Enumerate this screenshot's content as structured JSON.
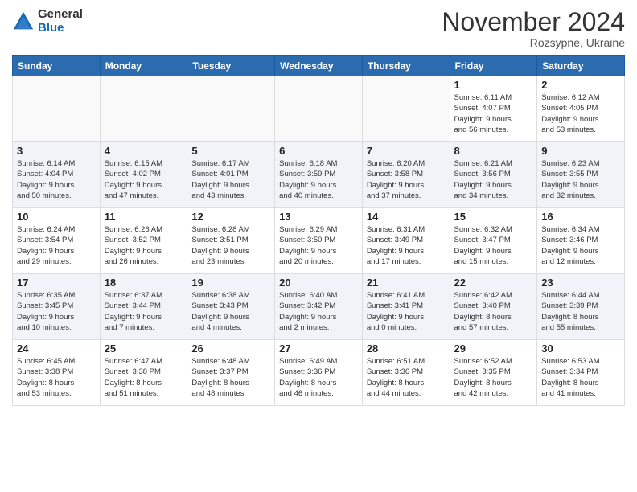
{
  "logo": {
    "general": "General",
    "blue": "Blue"
  },
  "header": {
    "month": "November 2024",
    "location": "Rozsypne, Ukraine"
  },
  "days_of_week": [
    "Sunday",
    "Monday",
    "Tuesday",
    "Wednesday",
    "Thursday",
    "Friday",
    "Saturday"
  ],
  "weeks": [
    [
      {
        "date": "",
        "info": ""
      },
      {
        "date": "",
        "info": ""
      },
      {
        "date": "",
        "info": ""
      },
      {
        "date": "",
        "info": ""
      },
      {
        "date": "",
        "info": ""
      },
      {
        "date": "1",
        "info": "Sunrise: 6:11 AM\nSunset: 4:07 PM\nDaylight: 9 hours\nand 56 minutes."
      },
      {
        "date": "2",
        "info": "Sunrise: 6:12 AM\nSunset: 4:05 PM\nDaylight: 9 hours\nand 53 minutes."
      }
    ],
    [
      {
        "date": "3",
        "info": "Sunrise: 6:14 AM\nSunset: 4:04 PM\nDaylight: 9 hours\nand 50 minutes."
      },
      {
        "date": "4",
        "info": "Sunrise: 6:15 AM\nSunset: 4:02 PM\nDaylight: 9 hours\nand 47 minutes."
      },
      {
        "date": "5",
        "info": "Sunrise: 6:17 AM\nSunset: 4:01 PM\nDaylight: 9 hours\nand 43 minutes."
      },
      {
        "date": "6",
        "info": "Sunrise: 6:18 AM\nSunset: 3:59 PM\nDaylight: 9 hours\nand 40 minutes."
      },
      {
        "date": "7",
        "info": "Sunrise: 6:20 AM\nSunset: 3:58 PM\nDaylight: 9 hours\nand 37 minutes."
      },
      {
        "date": "8",
        "info": "Sunrise: 6:21 AM\nSunset: 3:56 PM\nDaylight: 9 hours\nand 34 minutes."
      },
      {
        "date": "9",
        "info": "Sunrise: 6:23 AM\nSunset: 3:55 PM\nDaylight: 9 hours\nand 32 minutes."
      }
    ],
    [
      {
        "date": "10",
        "info": "Sunrise: 6:24 AM\nSunset: 3:54 PM\nDaylight: 9 hours\nand 29 minutes."
      },
      {
        "date": "11",
        "info": "Sunrise: 6:26 AM\nSunset: 3:52 PM\nDaylight: 9 hours\nand 26 minutes."
      },
      {
        "date": "12",
        "info": "Sunrise: 6:28 AM\nSunset: 3:51 PM\nDaylight: 9 hours\nand 23 minutes."
      },
      {
        "date": "13",
        "info": "Sunrise: 6:29 AM\nSunset: 3:50 PM\nDaylight: 9 hours\nand 20 minutes."
      },
      {
        "date": "14",
        "info": "Sunrise: 6:31 AM\nSunset: 3:49 PM\nDaylight: 9 hours\nand 17 minutes."
      },
      {
        "date": "15",
        "info": "Sunrise: 6:32 AM\nSunset: 3:47 PM\nDaylight: 9 hours\nand 15 minutes."
      },
      {
        "date": "16",
        "info": "Sunrise: 6:34 AM\nSunset: 3:46 PM\nDaylight: 9 hours\nand 12 minutes."
      }
    ],
    [
      {
        "date": "17",
        "info": "Sunrise: 6:35 AM\nSunset: 3:45 PM\nDaylight: 9 hours\nand 10 minutes."
      },
      {
        "date": "18",
        "info": "Sunrise: 6:37 AM\nSunset: 3:44 PM\nDaylight: 9 hours\nand 7 minutes."
      },
      {
        "date": "19",
        "info": "Sunrise: 6:38 AM\nSunset: 3:43 PM\nDaylight: 9 hours\nand 4 minutes."
      },
      {
        "date": "20",
        "info": "Sunrise: 6:40 AM\nSunset: 3:42 PM\nDaylight: 9 hours\nand 2 minutes."
      },
      {
        "date": "21",
        "info": "Sunrise: 6:41 AM\nSunset: 3:41 PM\nDaylight: 9 hours\nand 0 minutes."
      },
      {
        "date": "22",
        "info": "Sunrise: 6:42 AM\nSunset: 3:40 PM\nDaylight: 8 hours\nand 57 minutes."
      },
      {
        "date": "23",
        "info": "Sunrise: 6:44 AM\nSunset: 3:39 PM\nDaylight: 8 hours\nand 55 minutes."
      }
    ],
    [
      {
        "date": "24",
        "info": "Sunrise: 6:45 AM\nSunset: 3:38 PM\nDaylight: 8 hours\nand 53 minutes."
      },
      {
        "date": "25",
        "info": "Sunrise: 6:47 AM\nSunset: 3:38 PM\nDaylight: 8 hours\nand 51 minutes."
      },
      {
        "date": "26",
        "info": "Sunrise: 6:48 AM\nSunset: 3:37 PM\nDaylight: 8 hours\nand 48 minutes."
      },
      {
        "date": "27",
        "info": "Sunrise: 6:49 AM\nSunset: 3:36 PM\nDaylight: 8 hours\nand 46 minutes."
      },
      {
        "date": "28",
        "info": "Sunrise: 6:51 AM\nSunset: 3:36 PM\nDaylight: 8 hours\nand 44 minutes."
      },
      {
        "date": "29",
        "info": "Sunrise: 6:52 AM\nSunset: 3:35 PM\nDaylight: 8 hours\nand 42 minutes."
      },
      {
        "date": "30",
        "info": "Sunrise: 6:53 AM\nSunset: 3:34 PM\nDaylight: 8 hours\nand 41 minutes."
      }
    ]
  ]
}
